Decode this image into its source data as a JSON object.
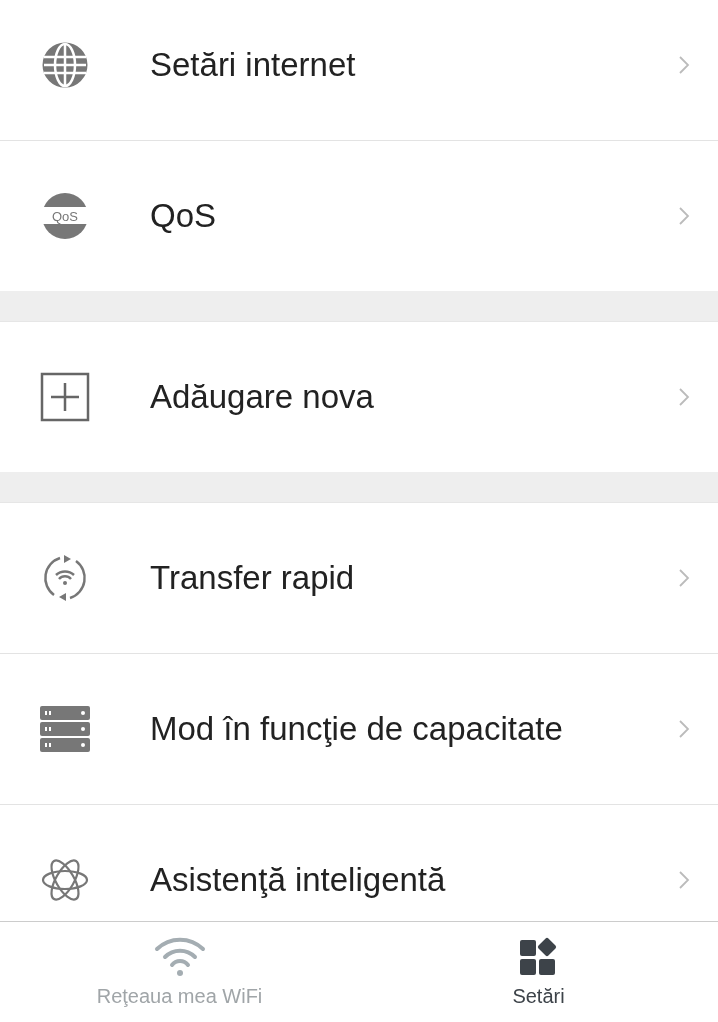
{
  "sections": [
    {
      "items": [
        {
          "kind": "globe",
          "label": "Setări internet"
        },
        {
          "kind": "qos",
          "label": "QoS",
          "icon_text": "QoS"
        }
      ]
    },
    {
      "items": [
        {
          "kind": "plus",
          "label": "Adăugare nova"
        }
      ]
    },
    {
      "items": [
        {
          "kind": "transfer",
          "label": "Transfer rapid"
        },
        {
          "kind": "server",
          "label": "Mod în funcţie de capacitate"
        },
        {
          "kind": "atom",
          "label": "Asistenţă inteligentă"
        }
      ]
    }
  ],
  "tabs": [
    {
      "kind": "wifi",
      "label": "Reţeaua mea WiFi",
      "selected": false
    },
    {
      "kind": "grid",
      "label": "Setări",
      "selected": true
    }
  ]
}
